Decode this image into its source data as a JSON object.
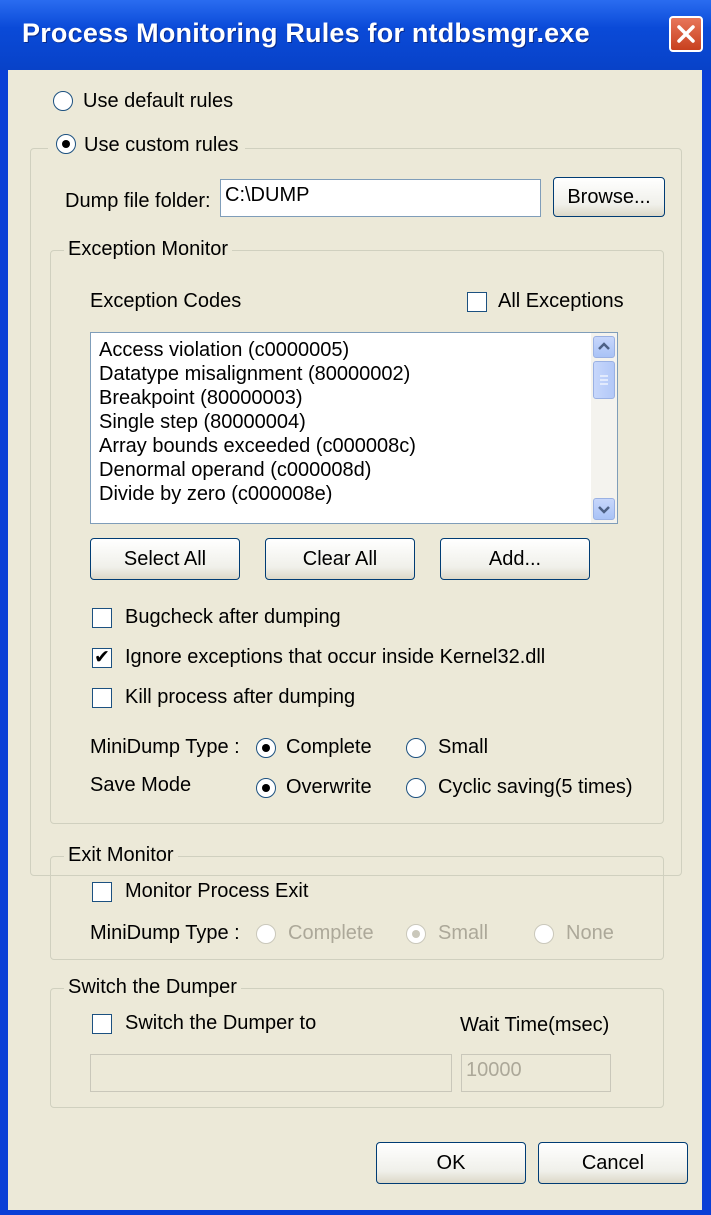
{
  "window": {
    "title": "Process Monitoring Rules for ntdbsmgr.exe",
    "close_icon": "close-icon"
  },
  "rules": {
    "default_label": "Use default rules",
    "custom_label": "Use custom rules",
    "selected": "custom"
  },
  "dump": {
    "label": "Dump file folder:",
    "value": "C:\\DUMP",
    "browse_label": "Browse..."
  },
  "exception_monitor": {
    "group_label": "Exception Monitor",
    "codes_label": "Exception Codes",
    "all_exceptions_label": "All Exceptions",
    "all_exceptions_checked": false,
    "codes": [
      "Access violation (c0000005)",
      "Datatype misalignment (80000002)",
      "Breakpoint (80000003)",
      "Single step (80000004)",
      "Array bounds exceeded (c000008c)",
      "Denormal operand (c000008d)",
      "Divide by zero (c000008e)"
    ],
    "select_all_label": "Select All",
    "clear_all_label": "Clear All",
    "add_label": "Add...",
    "options": [
      {
        "label": "Bugcheck after dumping",
        "checked": false
      },
      {
        "label": "Ignore exceptions that occur inside Kernel32.dll",
        "checked": true
      },
      {
        "label": "Kill process after dumping",
        "checked": false
      }
    ],
    "minidump_label": "MiniDump Type :",
    "minidump_complete": "Complete",
    "minidump_small": "Small",
    "minidump_selected": "Complete",
    "save_mode_label": "Save Mode",
    "save_overwrite": "Overwrite",
    "save_cyclic": "Cyclic saving(5 times)",
    "save_selected": "Overwrite"
  },
  "exit_monitor": {
    "group_label": "Exit Monitor",
    "monitor_label": "Monitor Process Exit",
    "monitor_checked": false,
    "minidump_label": "MiniDump Type :",
    "complete": "Complete",
    "small": "Small",
    "none": "None",
    "selected": "Small"
  },
  "switch_dumper": {
    "group_label": "Switch the Dumper",
    "switch_label": "Switch the Dumper to",
    "switch_checked": false,
    "path_value": "",
    "wait_label": "Wait Time(msec)",
    "wait_value": "10000"
  },
  "footer": {
    "ok_label": "OK",
    "cancel_label": "Cancel"
  }
}
